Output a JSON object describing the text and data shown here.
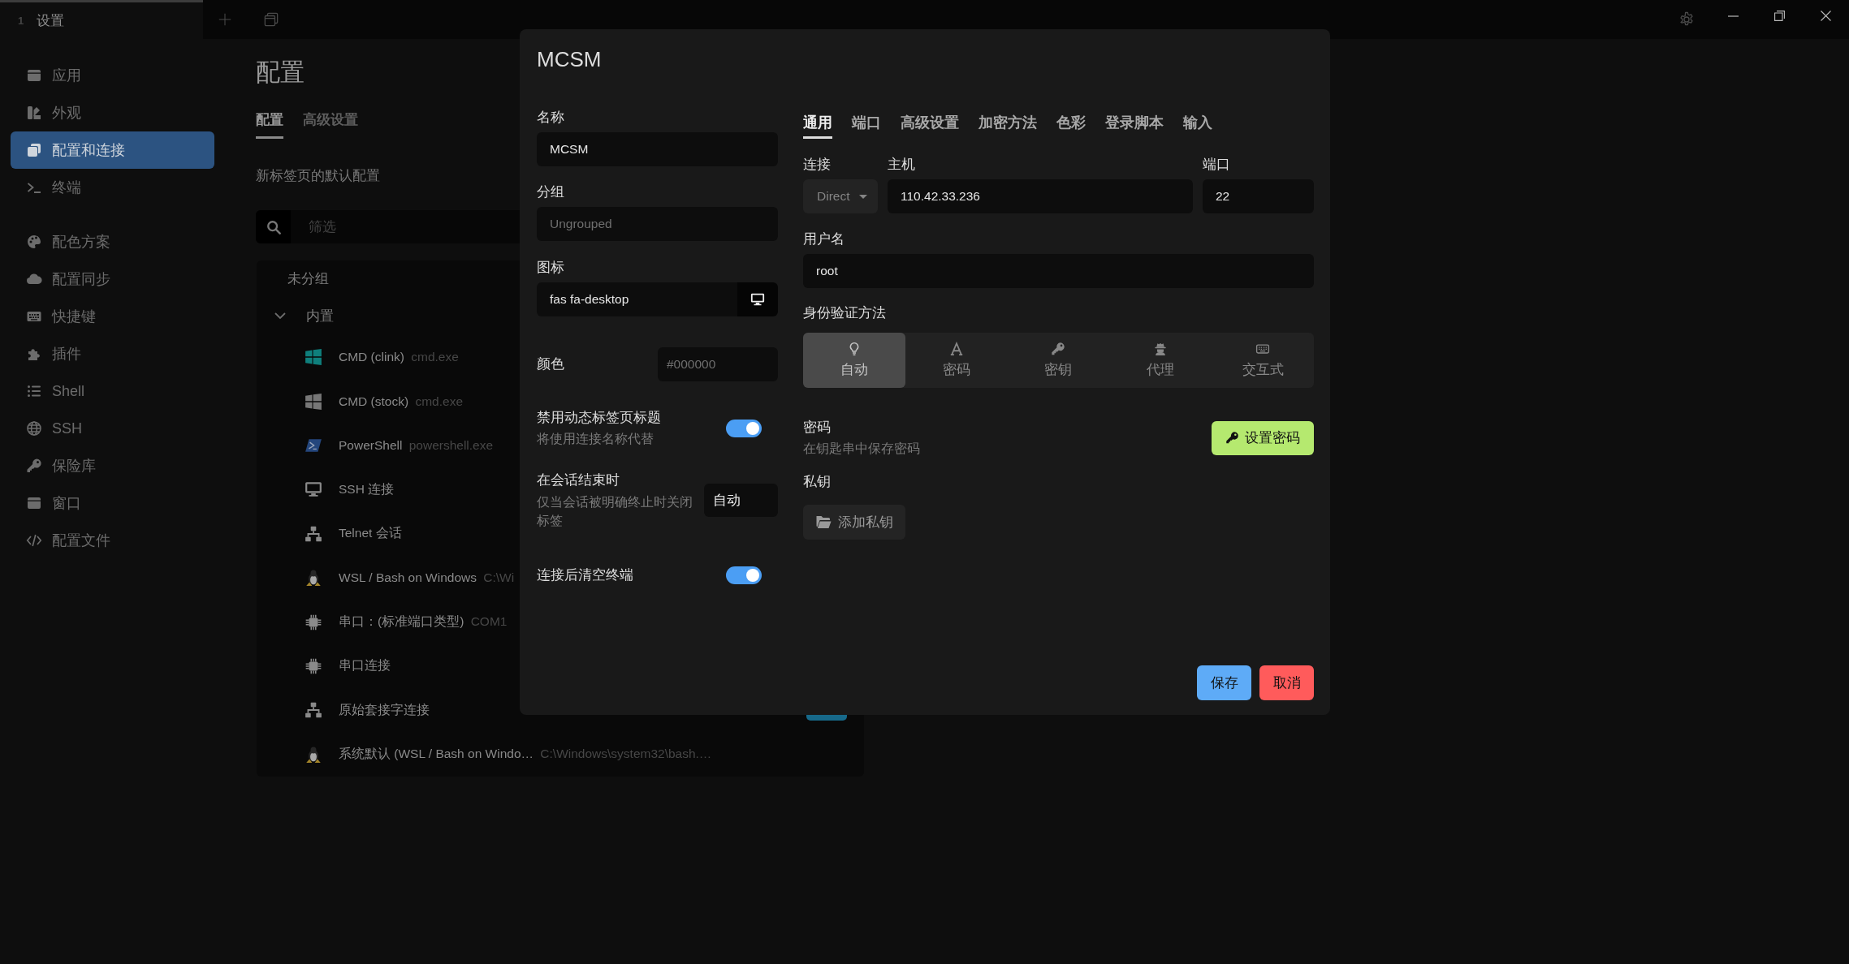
{
  "title_bar": {
    "tabs": [
      {
        "index": "1",
        "label": "设置",
        "selected": true
      }
    ]
  },
  "sidebar": {
    "groups": [
      {
        "items": [
          {
            "label": "应用",
            "kind": "app",
            "selected": false
          },
          {
            "label": "外观",
            "kind": "appearance",
            "selected": false
          },
          {
            "label": "配置和连接",
            "kind": "profiles",
            "selected": true
          },
          {
            "label": "终端",
            "kind": "terminal",
            "selected": false
          }
        ]
      },
      {
        "items": [
          {
            "label": "配色方案",
            "kind": "palette",
            "selected": false
          },
          {
            "label": "配置同步",
            "kind": "cloud",
            "selected": false
          },
          {
            "label": "快捷键",
            "kind": "keyboard",
            "selected": false
          },
          {
            "label": "插件",
            "kind": "puzzle",
            "selected": false
          },
          {
            "label": "Shell",
            "kind": "list",
            "selected": false
          },
          {
            "label": "SSH",
            "kind": "globe",
            "selected": false
          },
          {
            "label": "保险库",
            "kind": "key",
            "selected": false
          },
          {
            "label": "窗口",
            "kind": "window",
            "selected": false
          },
          {
            "label": "配置文件",
            "kind": "code",
            "selected": false
          }
        ]
      }
    ]
  },
  "page": {
    "title": "配置",
    "tabs": [
      {
        "label": "配置",
        "selected": true
      },
      {
        "label": "高级设置",
        "selected": false
      }
    ],
    "section_title": "新标签页的默认配置",
    "filter": {
      "placeholder": "筛选"
    },
    "ungrouped": {
      "label": "未分组"
    },
    "builtin": {
      "label": "内置",
      "expanded": true,
      "profiles": [
        {
          "name": "CMD (clink)",
          "command": "cmd.exe",
          "kind": "clink"
        },
        {
          "name": "CMD (stock)",
          "command": "cmd.exe",
          "kind": "cmd"
        },
        {
          "name": "PowerShell",
          "command": "powershell.exe",
          "kind": "powershell"
        },
        {
          "name": "SSH 连接",
          "kind": "desktop"
        },
        {
          "name": "Telnet 会话",
          "kind": "network"
        },
        {
          "name": "WSL / Bash on Windows",
          "command": "C:\\Wi",
          "kind": "penguin"
        },
        {
          "name": "串口：(标准端口类型)",
          "command": "COM1",
          "kind": "chip"
        },
        {
          "name": "串口连接",
          "kind": "chip"
        },
        {
          "name": "原始套接字连接",
          "kind": "network"
        },
        {
          "name": "系统默认 (WSL / Bash on Windo…",
          "command": "C:\\Windows\\system32\\bash.…",
          "kind": "penguin"
        }
      ]
    }
  },
  "dialog": {
    "title": "MCSM",
    "name": {
      "label": "名称",
      "value": "MCSM"
    },
    "group": {
      "label": "分组",
      "placeholder": "Ungrouped"
    },
    "icon": {
      "label": "图标",
      "value": "fas fa-desktop"
    },
    "color": {
      "label": "颜色",
      "placeholder": "#000000"
    },
    "disable_dynamic_title": {
      "label": "禁用动态标签页标题",
      "description": "将使用连接名称代替",
      "on": true
    },
    "session_end": {
      "label": "在会话结束时",
      "description": "仅当会话被明确终止时关闭标签",
      "value": "自动"
    },
    "clear_terminal": {
      "label": "连接后清空终端",
      "on": true
    },
    "tabs": [
      {
        "label": "通用",
        "selected": true
      },
      {
        "label": "端口",
        "selected": false
      },
      {
        "label": "高级设置",
        "selected": false
      },
      {
        "label": "加密方法",
        "selected": false
      },
      {
        "label": "色彩",
        "selected": false
      },
      {
        "label": "登录脚本",
        "selected": false
      },
      {
        "label": "输入",
        "selected": false
      }
    ],
    "connection": {
      "label": "连接",
      "value": "Direct",
      "disabled": true
    },
    "host": {
      "label": "主机",
      "value": "110.42.33.236"
    },
    "port": {
      "label": "端口",
      "value": "22"
    },
    "username": {
      "label": "用户名",
      "value": "root"
    },
    "auth": {
      "label": "身份验证方法",
      "methods": [
        {
          "label": "自动",
          "kind": "auto",
          "selected": true
        },
        {
          "label": "密码",
          "kind": "password",
          "selected": false
        },
        {
          "label": "密钥",
          "kind": "publickey",
          "selected": false
        },
        {
          "label": "代理",
          "kind": "agent",
          "selected": false
        },
        {
          "label": "交互式",
          "kind": "interactive",
          "selected": false
        }
      ]
    },
    "password": {
      "label": "密码",
      "description": "在钥匙串中保存密码",
      "button": "设置密码"
    },
    "private_key": {
      "label": "私钥",
      "button": "添加私钥"
    },
    "buttons": [
      {
        "label": "保存",
        "kind": "primary"
      },
      {
        "label": "取消",
        "kind": "danger"
      }
    ]
  }
}
